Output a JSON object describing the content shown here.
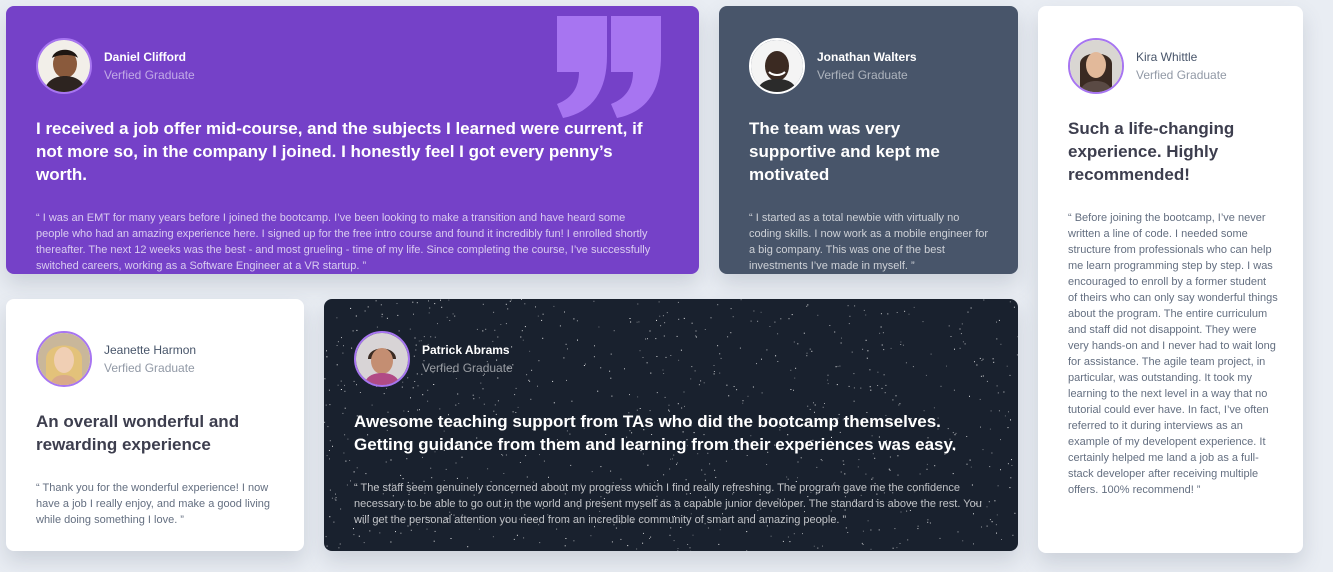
{
  "colors": {
    "purple": "#7541c8",
    "slate": "#48556a",
    "dark": "#19212e",
    "white": "#ffffff",
    "background": "#e9edf3",
    "avatar_ring": "#a775f1"
  },
  "testimonials": [
    {
      "name": "Daniel Clifford",
      "role": "Verfied Graduate",
      "headline": "I received a job offer mid-course, and the subjects I learned were current, if not more so, in the company I joined. I honestly feel I got every penny’s worth.",
      "quote": "“ I was an EMT for many years before I joined the bootcamp. I’ve been looking to make a transition and have heard some people who had an amazing experience here. I signed up for the free intro course and found it incredibly fun! I enrolled shortly thereafter. The next 12 weeks was the best - and most grueling - time of my life. Since completing the course, I’ve successfully switched careers, working as a Software Engineer at a VR startup. ”",
      "icon": "quotation-mark-icon"
    },
    {
      "name": "Jonathan Walters",
      "role": "Verfied Graduate",
      "headline": "The team was very supportive and kept me motivated",
      "quote": "“ I started as a total newbie with virtually no coding skills. I now work as a mobile engineer for a big company. This was one of the best investments I’ve made in myself. ”"
    },
    {
      "name": "Kira Whittle",
      "role": "Verfied Graduate",
      "headline": "Such a life-changing experience. Highly recommended!",
      "quote": "“ Before joining the bootcamp, I’ve never written a line of code. I needed some structure from professionals who can help me learn programming step by step. I was encouraged to enroll by a former student of theirs who can only say wonderful things about the program. The entire curriculum and staff did not disappoint. They were very hands-on and I never had to wait long for assistance. The agile team project, in particular, was outstanding. It took my learning to the next level in a way that no tutorial could ever have. In fact, I’ve often referred to it during interviews as an example of my developent experience. It certainly helped me land a job as a full-stack developer after receiving multiple offers. 100% recommend! ”"
    },
    {
      "name": "Jeanette Harmon",
      "role": "Verfied Graduate",
      "headline": "An overall wonderful and rewarding experience",
      "quote": "“ Thank you for the wonderful experience! I now have a job I really enjoy, and make a good living while doing something I love. ”"
    },
    {
      "name": "Patrick Abrams",
      "role": "Verfied Graduate",
      "headline": "Awesome teaching support from TAs who did the bootcamp themselves. Getting guidance from them and learning from their experiences was easy.",
      "quote": "“ The staff seem genuinely concerned about my progress which I find really refreshing. The program gave me the confidence necessary to be able to go out in the world and present myself as a capable junior developer. The standard is above the rest. You will get the personal attention you need from an incredible community of smart and amazing people. ”"
    }
  ]
}
